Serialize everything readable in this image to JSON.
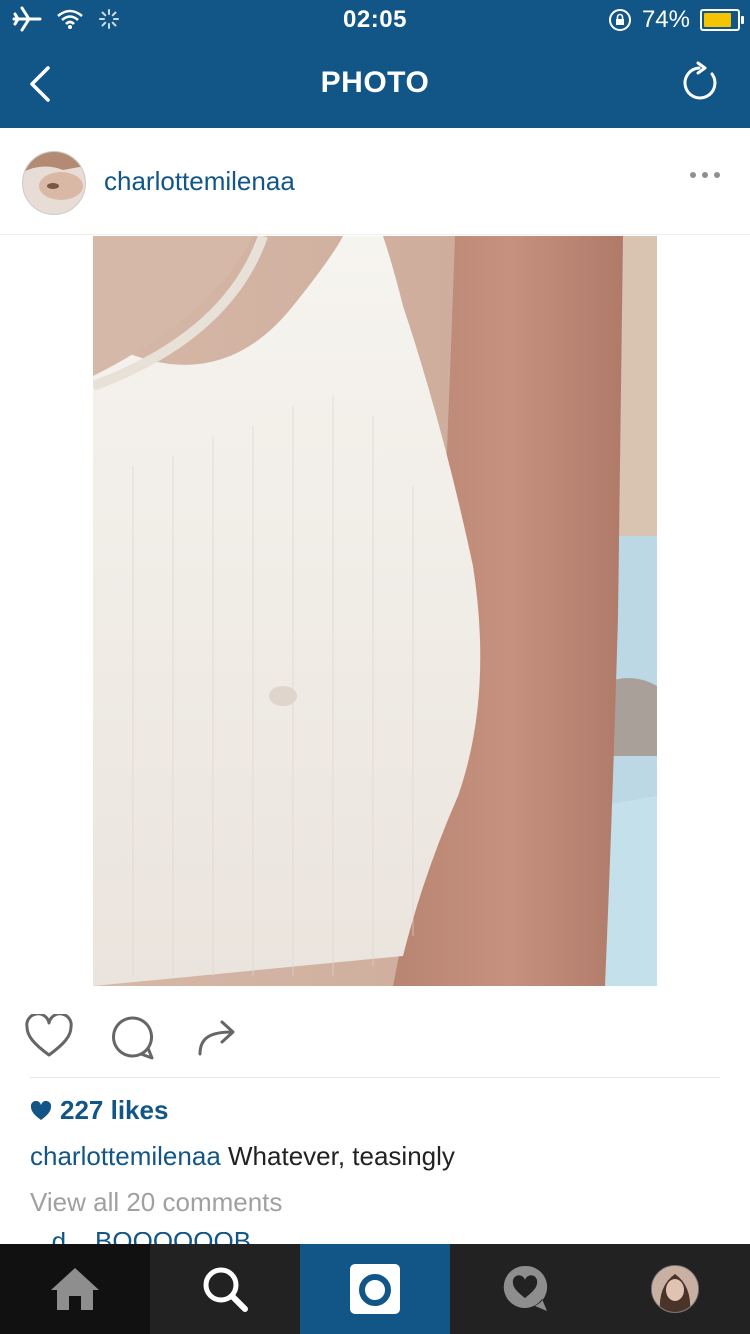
{
  "status": {
    "time": "02:05",
    "battery": "74%",
    "battery_level": 0.74
  },
  "nav": {
    "title": "PHOTO"
  },
  "post": {
    "username": "charlottemilenaa",
    "likes": "227 likes",
    "caption_user": "charlottemilenaa",
    "caption_text": " Whatever, teasingly",
    "view_all": "View all 20 comments",
    "partial_comment": "...d... BOOOOOOB"
  },
  "icons": {
    "back": "chevron-left-icon",
    "refresh": "refresh-icon",
    "more": "more-dots-icon",
    "like": "heart-outline-icon",
    "comment": "comment-icon",
    "share": "share-arrow-icon",
    "home": "home-icon",
    "search": "search-icon",
    "camera": "camera-icon",
    "activity": "activity-heart-icon",
    "profile": "profile-avatar-icon"
  },
  "colors": {
    "brand": "#125688",
    "tabbar": "#222222",
    "tab_active": "#125688"
  }
}
